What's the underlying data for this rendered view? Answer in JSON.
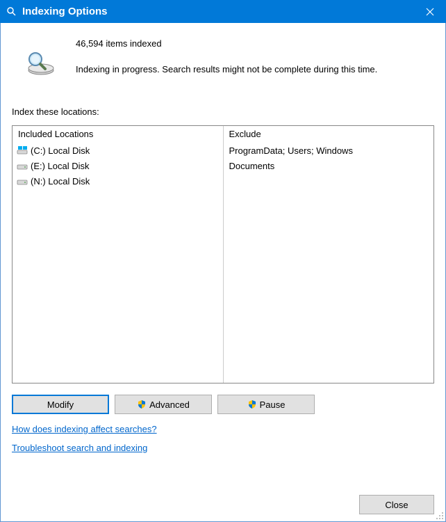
{
  "titlebar": {
    "title": "Indexing Options"
  },
  "status": {
    "items_indexed": "46,594 items indexed",
    "progress_message": "Indexing in progress. Search results might not be complete during this time."
  },
  "locations": {
    "section_label": "Index these locations:",
    "headers": {
      "included": "Included Locations",
      "exclude": "Exclude"
    },
    "items": [
      {
        "label": "(C:) Local Disk",
        "exclude": "ProgramData; Users; Windows",
        "icon": "windows-disk"
      },
      {
        "label": "(E:) Local Disk",
        "exclude": "Documents",
        "icon": "disk"
      },
      {
        "label": "(N:) Local Disk",
        "exclude": "",
        "icon": "disk"
      }
    ]
  },
  "buttons": {
    "modify": "Modify",
    "advanced": "Advanced",
    "pause": "Pause",
    "close": "Close"
  },
  "links": {
    "how_affects": "How does indexing affect searches?",
    "troubleshoot": "Troubleshoot search and indexing"
  }
}
